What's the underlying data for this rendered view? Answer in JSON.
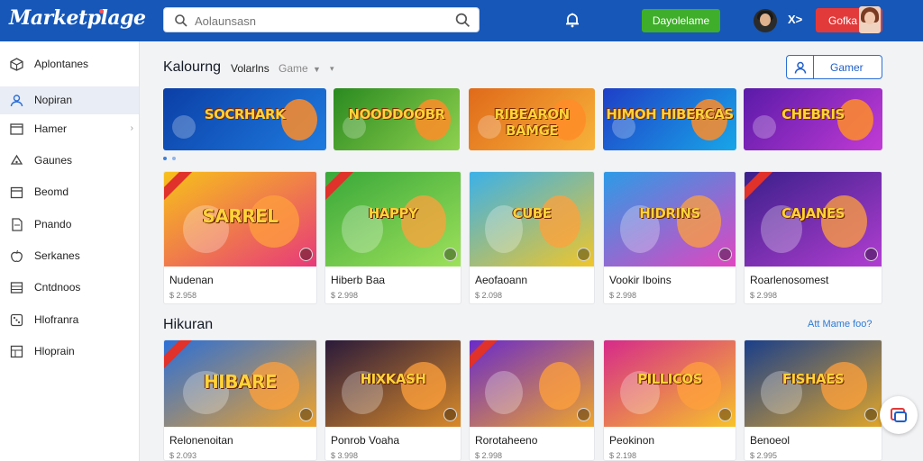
{
  "header": {
    "logo": "Marketplage",
    "search": {
      "value": "",
      "placeholder": "Aolaunsasn"
    },
    "green_button": "Dayolelame",
    "user_short": "X",
    "red_button": "Gofka",
    "accent": "#1657b8"
  },
  "sidebar": {
    "items": [
      {
        "label": "Aplontanes",
        "icon": "cube-icon"
      },
      {
        "label": "Nopiran",
        "icon": "user-icon",
        "active": true
      },
      {
        "label": "Hamer",
        "icon": "window-icon",
        "has_chevron": true,
        "chevron": "›"
      },
      {
        "label": "Gaunes",
        "icon": "controller-icon"
      },
      {
        "label": "Beomd",
        "icon": "calendar-icon"
      },
      {
        "label": "Pnando",
        "icon": "document-icon"
      },
      {
        "label": "Serkanes",
        "icon": "apple-icon"
      },
      {
        "label": "Cntdnoos",
        "icon": "layers-icon"
      },
      {
        "label": "Hlofranra",
        "icon": "dice-icon"
      },
      {
        "label": "Hloprain",
        "icon": "table-icon"
      }
    ]
  },
  "main": {
    "section1": {
      "title": "Kalourng",
      "tab_active": "Volarlns",
      "tab_muted": "Game",
      "game_button": "Gamer"
    },
    "banners": [
      {
        "text": "SOCRHARK",
        "colors": [
          "#0b3fa6",
          "#1e7be0"
        ]
      },
      {
        "text": "NOODDOOBR",
        "colors": [
          "#2a8a20",
          "#8fd14f"
        ]
      },
      {
        "text": "RIBEARON BAMGE",
        "colors": [
          "#e06a1a",
          "#f7b33a"
        ]
      },
      {
        "text": "HIMOH HIBERCAS",
        "colors": [
          "#1f3fc7",
          "#18a6e8"
        ]
      },
      {
        "text": "CHEBRIS",
        "colors": [
          "#5a1aa8",
          "#c23bd6"
        ]
      }
    ],
    "row1": [
      {
        "title": "Nudenan",
        "price": "$ 2.958",
        "art": "SARREL",
        "colors": [
          "#f7c11a",
          "#e8397a"
        ],
        "ribbon": true
      },
      {
        "title": "Hiberb Baa",
        "price": "$ 2.998",
        "art": "HAPPY",
        "colors": [
          "#39a83a",
          "#9ee15a"
        ],
        "ribbon": true
      },
      {
        "title": "Aeofaoann",
        "price": "$ 2.098",
        "art": "CUBE",
        "colors": [
          "#3bb1e8",
          "#f0c62a"
        ],
        "ribbon": false
      },
      {
        "title": "Vookir Iboins",
        "price": "$ 2.998",
        "art": "HIDRINS",
        "colors": [
          "#2c9be6",
          "#e046c1"
        ],
        "ribbon": false
      },
      {
        "title": "Roarlenosomest",
        "price": "$ 2.998",
        "art": "CAJANES",
        "colors": [
          "#3a1f8a",
          "#b13ed1"
        ],
        "ribbon": true
      }
    ],
    "section2": {
      "title": "Hikuran",
      "link": "Att Mame foo?"
    },
    "row2": [
      {
        "title": "Relonenoitan",
        "price": "$ 2.093",
        "art": "HIBARE",
        "colors": [
          "#2c6fd6",
          "#f0a32a"
        ],
        "ribbon": true
      },
      {
        "title": "Ponrob Voaha",
        "price": "$ 3.998",
        "art": "HIXKASH",
        "colors": [
          "#2a1a3a",
          "#d98a2a"
        ],
        "ribbon": false
      },
      {
        "title": "Rorotaheeno",
        "price": "$ 2.998",
        "art": "",
        "colors": [
          "#6a2bc9",
          "#f0a52a"
        ],
        "ribbon": true
      },
      {
        "title": "Peokinon",
        "price": "$ 2.198",
        "art": "PILLICOS",
        "colors": [
          "#d62a8a",
          "#f7c22a"
        ],
        "ribbon": false
      },
      {
        "title": "Benoeol",
        "price": "$ 2.995",
        "art": "FISHAES",
        "colors": [
          "#1a3f8a",
          "#e0a52a"
        ],
        "ribbon": false
      }
    ]
  }
}
